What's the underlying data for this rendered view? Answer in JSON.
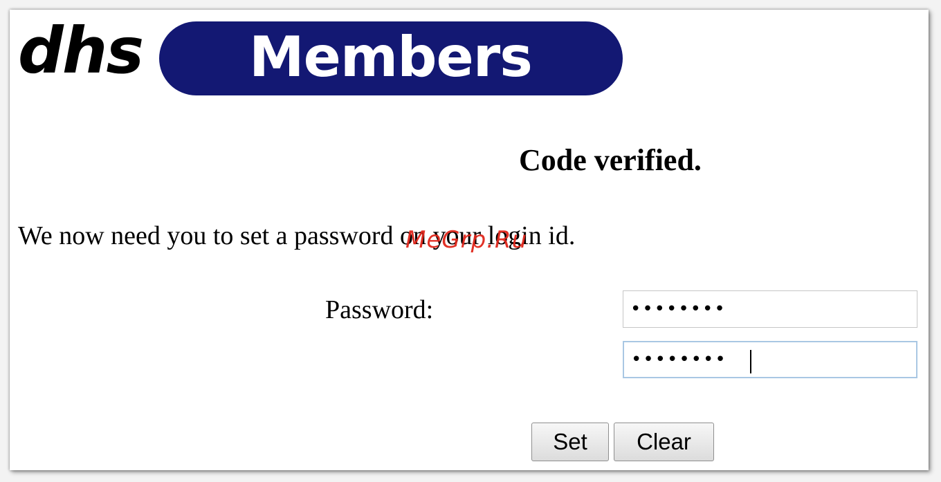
{
  "logo": {
    "left_text": "dhs",
    "pill_text": "Members",
    "pill_color": "#131873"
  },
  "heading": "Code verified.",
  "instructions": "We now need you to set a password on your login id.",
  "watermark": "MeGrp.Ru",
  "form": {
    "password_label": "Password:",
    "password_value": "••••••••",
    "confirm_value": "••••••••",
    "set_label": "Set",
    "clear_label": "Clear"
  },
  "colors": {
    "watermark": "#e0261b",
    "focus_border": "#a9c7e3"
  }
}
